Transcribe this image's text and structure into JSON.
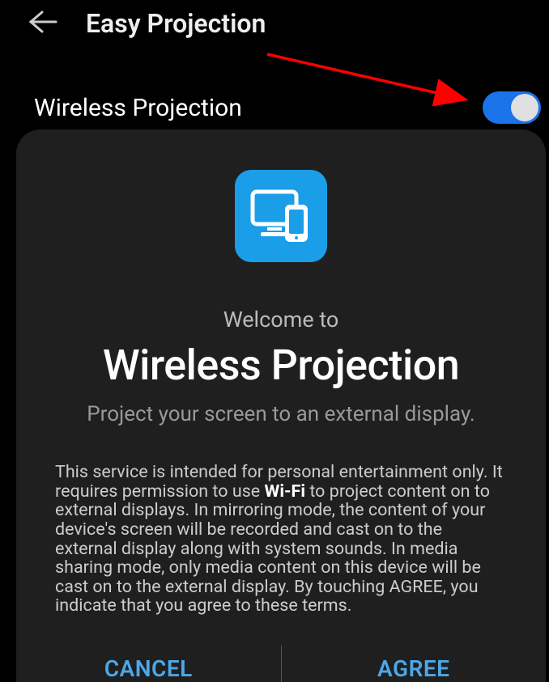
{
  "header": {
    "title": "Easy Projection"
  },
  "setting": {
    "label": "Wireless Projection",
    "toggle_on": true
  },
  "dialog": {
    "welcome": "Welcome to",
    "title": "Wireless Projection",
    "subtitle": "Project your screen to an external display.",
    "body_pre": "This service is intended for personal entertainment only. It requires permission to use ",
    "body_bold": "Wi-Fi",
    "body_post": " to project content on to external displays. In mirroring mode, the content of your device's screen will be recorded and cast on to the external display along with system sounds. In media sharing mode, only media content on this device will be cast on to the external display. By touching AGREE, you indicate that you agree to these terms.",
    "cancel": "CANCEL",
    "agree": "AGREE"
  }
}
